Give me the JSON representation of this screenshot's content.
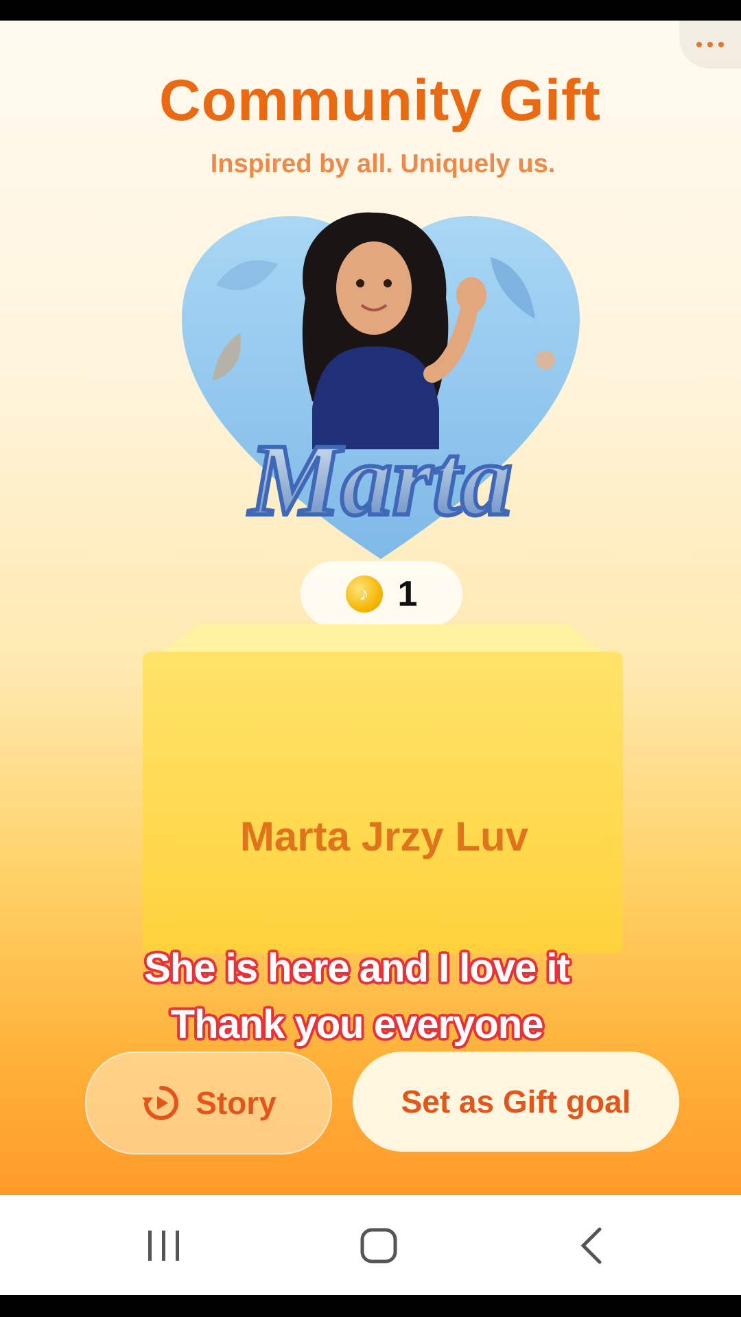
{
  "header": {
    "title": "Community Gift",
    "subtitle": "Inspired by all. Uniquely us.",
    "more_icon": "more-dots-icon"
  },
  "gift": {
    "name_art": "Marta",
    "price": "1",
    "coin_icon": "tiktok-coin-icon"
  },
  "creator": {
    "name": "Marta Jrzy Luv"
  },
  "captions": {
    "line1": "She is here and I love it",
    "line2": "Thank you everyone"
  },
  "actions": {
    "story_label": "Story",
    "story_icon": "replay-icon",
    "goal_label": "Set as Gift goal"
  },
  "system_nav": {
    "recents_icon": "recents-icon",
    "home_icon": "home-icon",
    "back_icon": "back-icon"
  },
  "colors": {
    "accent": "#ea6a14",
    "caption_stroke": "#e8323a",
    "heart": "#8fc7ee"
  }
}
